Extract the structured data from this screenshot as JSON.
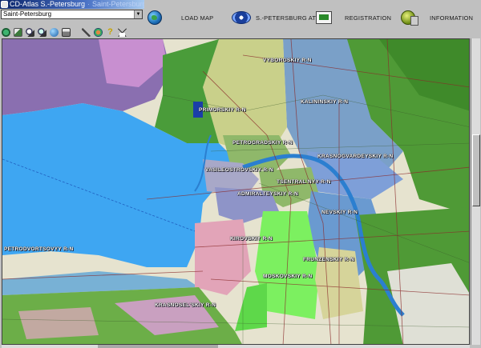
{
  "window": {
    "title": "CD-Atlas S.-Petersburg",
    "subtitle": "Saint-Petersburg"
  },
  "city_select": {
    "value": "Saint-Petersburg"
  },
  "nav": {
    "load_map": "LOAD MAP",
    "atlas": "S.-PETERSBURG ATLAS",
    "registration": "REGISTRATION",
    "information": "INFORMATION"
  },
  "toolbar": {
    "help_glyph": "?"
  },
  "map": {
    "districts": {
      "vyborgsky": "VYBORGSKIY R-N",
      "kalininsky": "KALININSKIY R-N",
      "primorsky": "PRIMORSKIY R-N",
      "petrogradsky": "PETROGRADSKIY R-N",
      "krasnogvardeisky": "KRASNOGVARDEYSKIY R-N",
      "vasileostrovsky": "VASILEOSTROVSKIY R-N",
      "tsentralny": "TSENTRAL'NYY R-N",
      "admiralteisky": "ADMIRALTEYSKIY R-N",
      "nevsky": "NEVSKIY R-N",
      "kirovsky": "KIROVSKIY R-N",
      "petrodvortsovy": "PETRODVORTSOVYY R-N",
      "frunzensky": "FRUNZENSKIY R-N",
      "moskovsky": "MOSKOVSKIY R-N",
      "krasnoselsky": "KRASNOSEL'SKIY R-N"
    }
  },
  "colors": {
    "water": "#3ea6f2",
    "park": "#3a8a2c",
    "accent_green": "#7cf060"
  }
}
